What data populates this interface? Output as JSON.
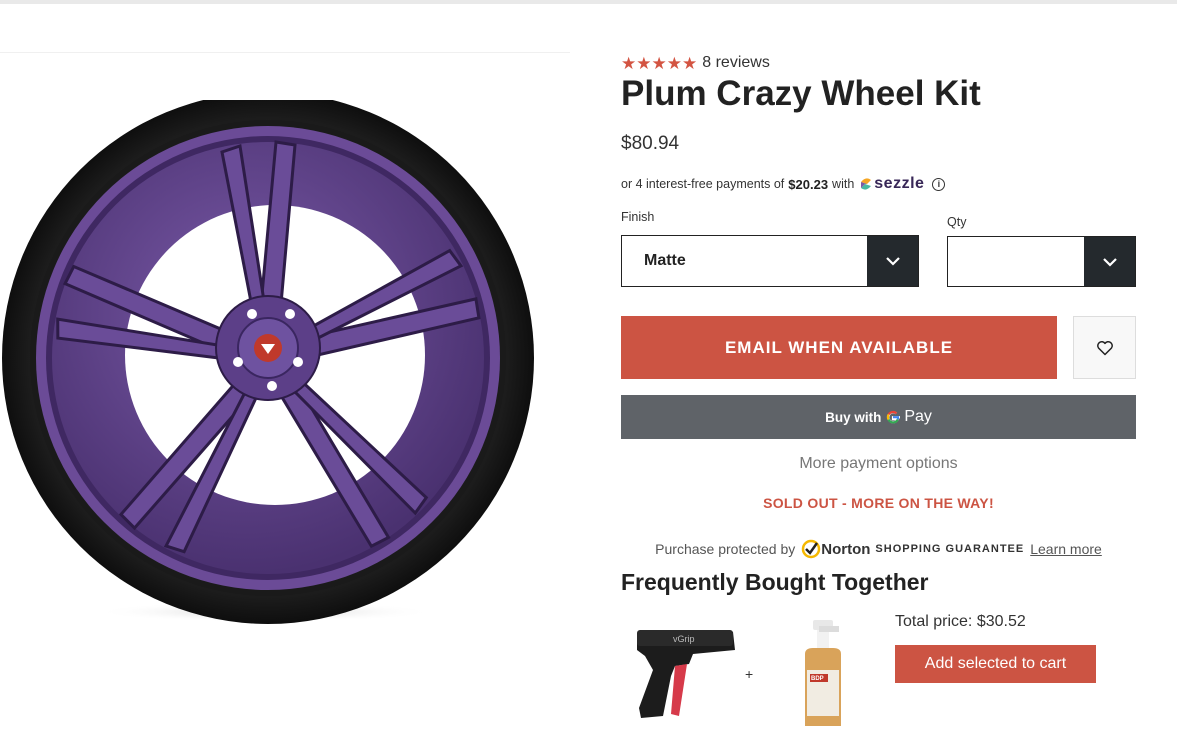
{
  "product": {
    "rating_stars": 5,
    "reviews_label": "8 reviews",
    "title": "Plum Crazy Wheel Kit",
    "price": "$80.94"
  },
  "sezzle": {
    "prefix": "or 4 interest-free payments of",
    "amount": "$20.23",
    "with": "with",
    "brand": "sezzle",
    "info_icon": "info-circle-icon"
  },
  "options": {
    "finish_label": "Finish",
    "finish_value": "Matte",
    "qty_label": "Qty",
    "qty_value": ""
  },
  "actions": {
    "email_label": "EMAIL WHEN AVAILABLE",
    "wishlist_icon": "heart-icon",
    "gpay_prefix": "Buy with",
    "gpay_brand": "Pay",
    "more_payment": "More payment options",
    "sold_out": "SOLD OUT - MORE ON THE WAY!"
  },
  "norton": {
    "prefix": "Purchase protected by",
    "brand": "Norton",
    "guarantee": "SHOPPING GUARANTEE",
    "learn_more": "Learn more"
  },
  "fbt": {
    "title": "Frequently Bought Together",
    "plus": "+",
    "total_label": "Total price: $30.52",
    "add_button": "Add selected to cart",
    "product1_label": "vGrip",
    "product2_label": "BDP"
  },
  "colors": {
    "accent": "#cc5443",
    "dark": "#24292d",
    "gpay": "#5f6368",
    "wheel": "#5b3f86",
    "star": "#d35442"
  }
}
